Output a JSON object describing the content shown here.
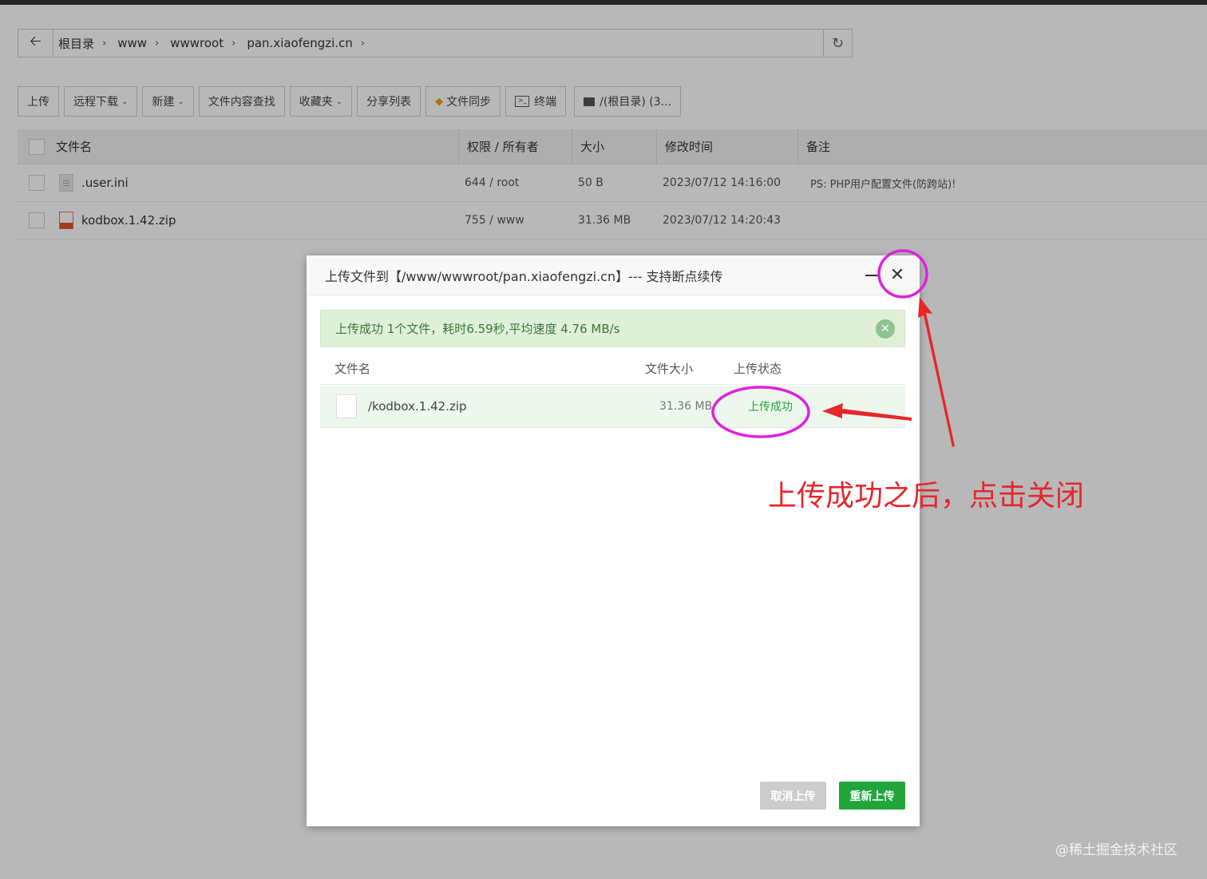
{
  "breadcrumb": {
    "segments": [
      "根目录",
      "www",
      "wwwroot",
      "pan.xiaofengzi.cn"
    ]
  },
  "toolbar": {
    "upload": "上传",
    "remote_download": "远程下载",
    "new": "新建",
    "content_search": "文件内容查找",
    "favorites": "收藏夹",
    "share_list": "分享列表",
    "file_sync": "文件同步",
    "terminal": "终端",
    "disk": "/(根目录) (3..."
  },
  "file_table": {
    "headers": {
      "name": "文件名",
      "perm": "权限 / 所有者",
      "size": "大小",
      "mtime": "修改时间",
      "note": "备注"
    },
    "rows": [
      {
        "name": ".user.ini",
        "perm": "644 / root",
        "size": "50 B",
        "mtime": "2023/07/12 14:16:00",
        "note": "PS: PHP用户配置文件(防跨站)!"
      },
      {
        "name": "kodbox.1.42.zip",
        "perm": "755 / www",
        "size": "31.36 MB",
        "mtime": "2023/07/12 14:20:43",
        "note": ""
      }
    ]
  },
  "dialog": {
    "title": "上传文件到【/www/wwwroot/pan.xiaofengzi.cn】--- 支持断点续传",
    "success_message": "上传成功 1个文件，耗时6.59秒,平均速度 4.76 MB/s",
    "list_headers": {
      "name": "文件名",
      "size": "文件大小",
      "status": "上传状态"
    },
    "item": {
      "name": "/kodbox.1.42.zip",
      "size": "31.36 MB",
      "status": "上传成功"
    },
    "cancel_button": "取消上传",
    "retry_button": "重新上传"
  },
  "annotation": {
    "text": "上传成功之后，点击关闭",
    "color": "#e8262a",
    "circle_color": "#e020e0"
  },
  "watermark": "@稀土掘金技术社区",
  "colors": {
    "success_green": "#20a53a",
    "success_bg": "#dff0d8"
  }
}
